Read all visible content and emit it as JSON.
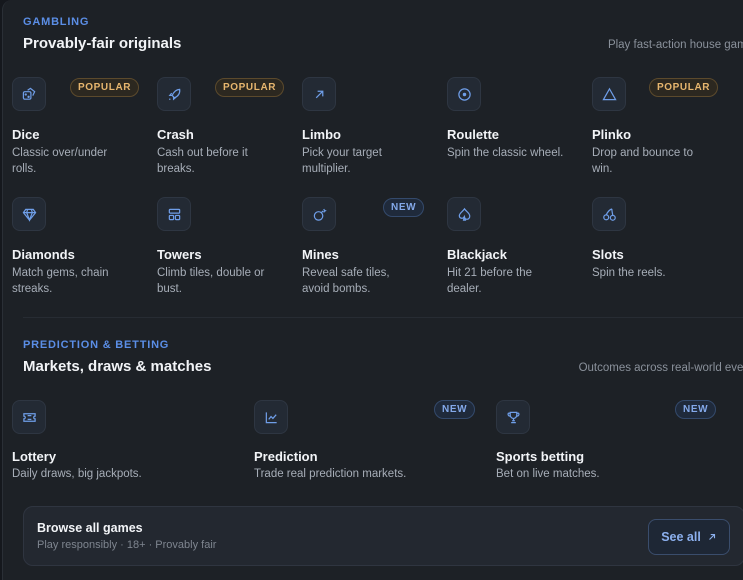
{
  "gambling": {
    "eyebrow": "GAMBLING",
    "title": "Provably-fair originals",
    "subtitle": "Play fast-action house games.",
    "games": [
      {
        "name": "Dice",
        "desc": "Classic over/under rolls.",
        "badge": "POPULAR",
        "icon": "dice-icon"
      },
      {
        "name": "Crash",
        "desc": "Cash out before it breaks.",
        "badge": "POPULAR",
        "icon": "rocket-icon"
      },
      {
        "name": "Limbo",
        "desc": "Pick your target multiplier.",
        "badge": "",
        "icon": "arrow-up-right-icon"
      },
      {
        "name": "Roulette",
        "desc": "Spin the classic wheel.",
        "badge": "",
        "icon": "target-icon"
      },
      {
        "name": "Plinko",
        "desc": "Drop and bounce to win.",
        "badge": "POPULAR",
        "icon": "triangle-icon"
      },
      {
        "name": "Diamonds",
        "desc": "Match gems, chain streaks.",
        "badge": "",
        "icon": "gem-icon"
      },
      {
        "name": "Towers",
        "desc": "Climb tiles, double or bust.",
        "badge": "",
        "icon": "tower-grid-icon"
      },
      {
        "name": "Mines",
        "desc": "Reveal safe tiles, avoid bombs.",
        "badge": "NEW",
        "icon": "bomb-icon"
      },
      {
        "name": "Blackjack",
        "desc": "Hit 21 before the dealer.",
        "badge": "",
        "icon": "spade-icon"
      },
      {
        "name": "Slots",
        "desc": "Spin the reels.",
        "badge": "",
        "icon": "cherries-icon"
      }
    ]
  },
  "prediction": {
    "eyebrow": "PREDICTION & BETTING",
    "title": "Markets, draws & matches",
    "subtitle": "Outcomes across real-world events.",
    "games": [
      {
        "name": "Lottery",
        "desc": "Daily draws, big jackpots.",
        "badge": "",
        "icon": "ticket-icon"
      },
      {
        "name": "Prediction",
        "desc": "Trade real prediction markets.",
        "badge": "NEW",
        "icon": "line-chart-icon"
      },
      {
        "name": "Sports betting",
        "desc": "Bet on live matches.",
        "badge": "NEW",
        "icon": "trophy-icon"
      }
    ]
  },
  "browse": {
    "title": "Browse all games",
    "subtitle": "Play responsibly · 18+ · Provably fair",
    "button_label": "See all",
    "button_icon": "arrow-up-right-icon"
  },
  "colors": {
    "background": "#1d2126",
    "accent": "#5b8ee6",
    "popular_badge": "#e7b66e",
    "new_badge": "#84a9ea"
  }
}
